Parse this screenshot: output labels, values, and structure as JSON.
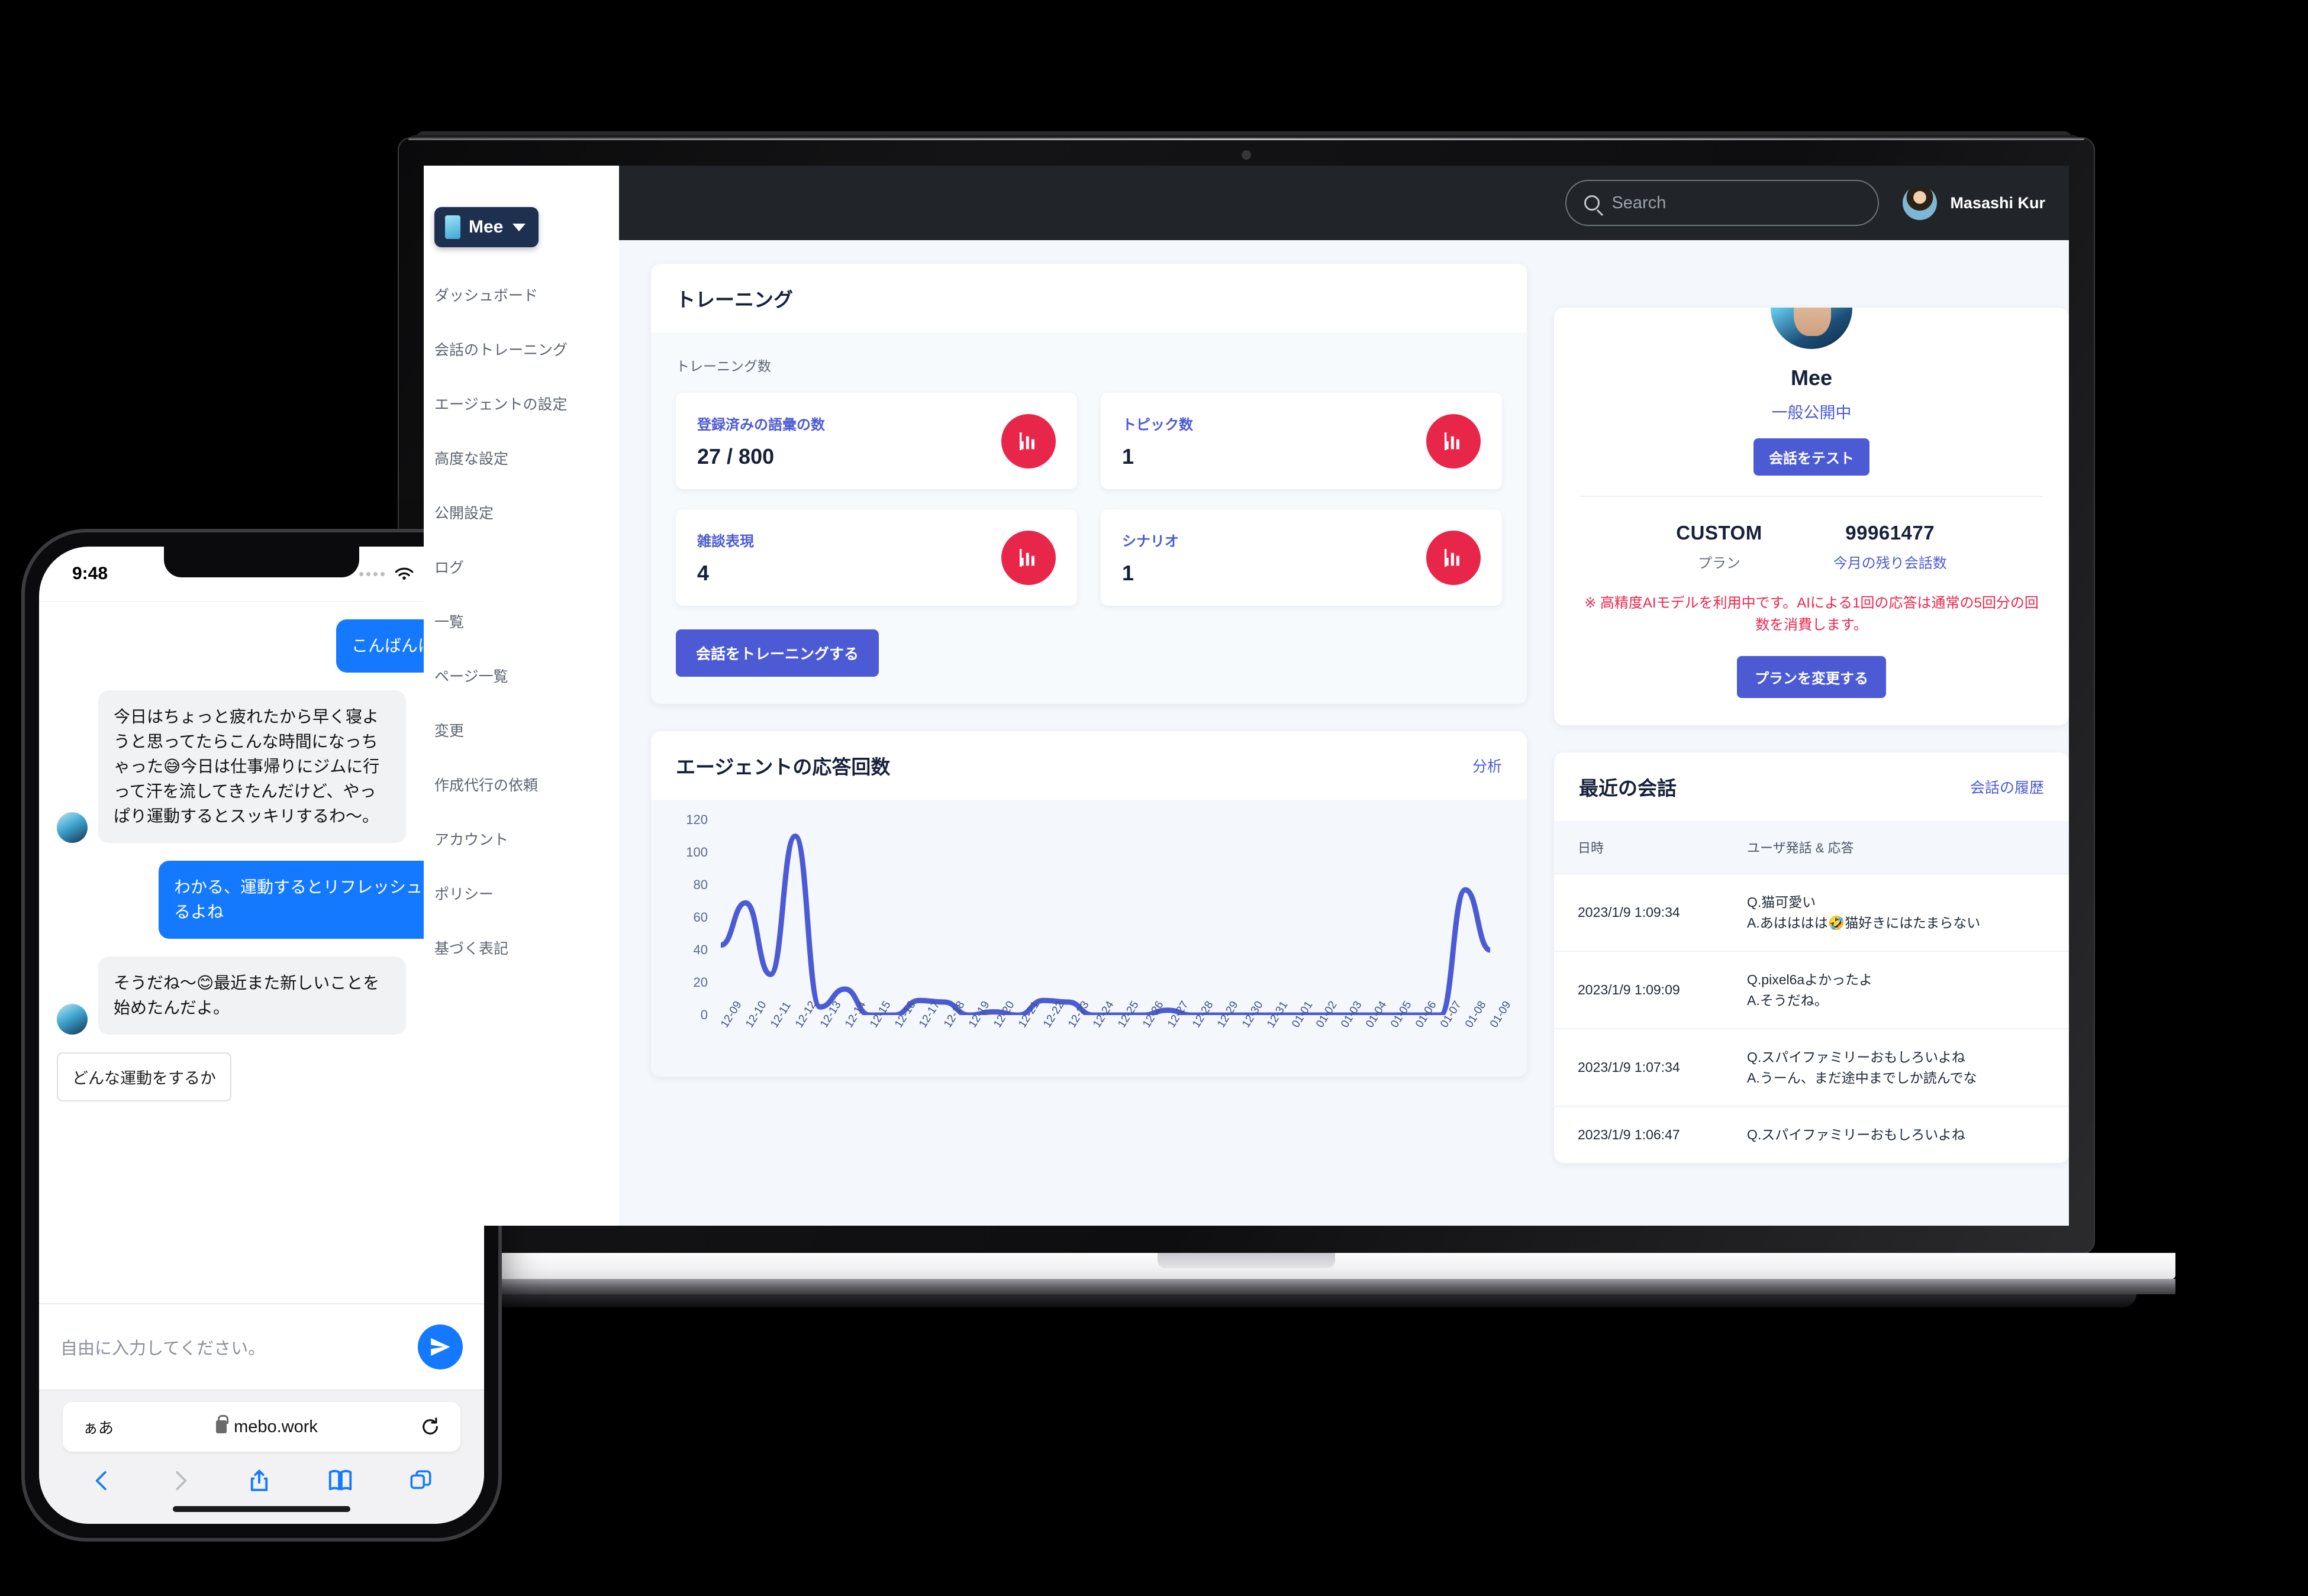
{
  "app": {
    "brand": {
      "name": "Mee",
      "caret_icon": "chevron-down-icon"
    },
    "sidebar": [
      {
        "label": "ダッシュボード"
      },
      {
        "label": "会話のトレーニング"
      },
      {
        "label": "エージェントの設定"
      },
      {
        "label": "高度な設定"
      },
      {
        "label": "公開設定"
      },
      {
        "label": "ログ"
      },
      {
        "label": "一覧"
      },
      {
        "label": "ページ一覧"
      },
      {
        "label": "変更"
      },
      {
        "label": "作成代行の依頼"
      },
      {
        "label": "アカウント"
      },
      {
        "label": "ポリシー"
      },
      {
        "label": "基づく表記"
      }
    ],
    "topbar": {
      "search_placeholder": "Search",
      "search_icon": "search-icon",
      "user_name": "Masashi Kur",
      "avatar_icon": "avatar"
    },
    "training": {
      "title": "トレーニング",
      "sub_label": "トレーニング数",
      "stats": [
        {
          "label": "登録済みの語彙の数",
          "value": "27 / 800",
          "icon": "bar-chart-icon"
        },
        {
          "label": "トピック数",
          "value": "1",
          "icon": "bar-chart-icon"
        },
        {
          "label": "雑談表現",
          "value": "4",
          "icon": "bar-chart-icon"
        },
        {
          "label": "シナリオ",
          "value": "1",
          "icon": "bar-chart-icon"
        }
      ],
      "button": "会話をトレーニングする"
    },
    "chart_card": {
      "title": "エージェントの応答回数",
      "link": "分析"
    },
    "profile": {
      "name": "Mee",
      "visibility": "一般公開中",
      "test_button": "会話をテスト",
      "plan_value": "CUSTOM",
      "plan_label": "プラン",
      "quota_value": "99961477",
      "quota_label": "今月の残り会話数",
      "warning": "※ 高精度AIモデルを利用中です。AIによる1回の応答は通常の5回分の回数を消費します。",
      "change_plan_button": "プランを変更する"
    },
    "recent": {
      "title": "最近の会話",
      "link": "会話の履歴",
      "columns": [
        "日時",
        "ユーザ発話 & 応答"
      ],
      "rows": [
        {
          "date": "2023/1/9 1:09:34",
          "q": "Q.猫可愛い",
          "a": "A.あはははは🤣猫好きにはたまらない"
        },
        {
          "date": "2023/1/9 1:09:09",
          "q": "Q.pixel6aよかったよ",
          "a": "A.そうだね。"
        },
        {
          "date": "2023/1/9 1:07:34",
          "q": "Q.スパイファミリーおもしろいよね",
          "a": "A.うーん、まだ途中までしか読んでな"
        },
        {
          "date": "2023/1/9 1:06:47",
          "q": "Q.スパイファミリーおもしろいよね",
          "a": ""
        }
      ]
    }
  },
  "chart_data": {
    "type": "line",
    "title": "エージェントの応答回数",
    "xlabel": "",
    "ylabel": "",
    "ylim": [
      0,
      120
    ],
    "yticks": [
      0,
      20,
      40,
      60,
      80,
      100,
      120
    ],
    "grid": false,
    "legend": "none",
    "categories": [
      "12-09",
      "12-10",
      "12-11",
      "12-12",
      "12-13",
      "12-14",
      "12-15",
      "12-16",
      "12-17",
      "12-18",
      "12-19",
      "12-20",
      "12-21",
      "12-22",
      "12-23",
      "12-24",
      "12-25",
      "12-26",
      "12-27",
      "12-28",
      "12-29",
      "12-30",
      "12-31",
      "01-01",
      "01-02",
      "01-03",
      "01-04",
      "01-05",
      "01-06",
      "01-07",
      "01-08",
      "01-09"
    ],
    "values": [
      43,
      69,
      25,
      110,
      5,
      16,
      0,
      0,
      9,
      8,
      0,
      2,
      0,
      9,
      8,
      0,
      0,
      0,
      3,
      0,
      0,
      0,
      0,
      0,
      0,
      0,
      0,
      0,
      0,
      0,
      77,
      40
    ]
  },
  "phone": {
    "status": {
      "time": "9:48",
      "wifi_icon": "wifi-icon",
      "battery_icon": "battery-icon",
      "signal_icon": "signal-dots-icon"
    },
    "messages": [
      {
        "side": "me",
        "text": "こんばんは！"
      },
      {
        "side": "them",
        "text": "今日はちょっと疲れたから早く寝ようと思ってたらこんな時間になっちゃった😅今日は仕事帰りにジムに行って汗を流してきたんだけど、やっぱり運動するとスッキリするわ〜。"
      },
      {
        "side": "me",
        "text": "わかる、運動するとリフレッシュするよね"
      },
      {
        "side": "them",
        "text": "そうだね〜😊最近また新しいことを始めたんだよ。"
      }
    ],
    "suggestion": "どんな運動をするか",
    "input_placeholder": "自由に入力してください。",
    "send_icon": "send-icon",
    "safari": {
      "aa_label": "ぁあ",
      "url": "mebo.work",
      "lock_icon": "lock-icon",
      "reload_icon": "reload-icon",
      "back_icon": "back-icon",
      "forward_icon": "forward-icon",
      "share_icon": "share-icon",
      "bookmarks_icon": "bookmarks-icon",
      "tabs_icon": "tabs-icon"
    }
  },
  "colors": {
    "brand_navy": "#1e3050",
    "accent_indigo": "#4c5bd4",
    "accent_red": "#e8264a",
    "warning_red": "#f0264e",
    "ios_blue": "#1479ff",
    "topbar_dark": "#212529",
    "board_bg": "#f4f7fb"
  }
}
